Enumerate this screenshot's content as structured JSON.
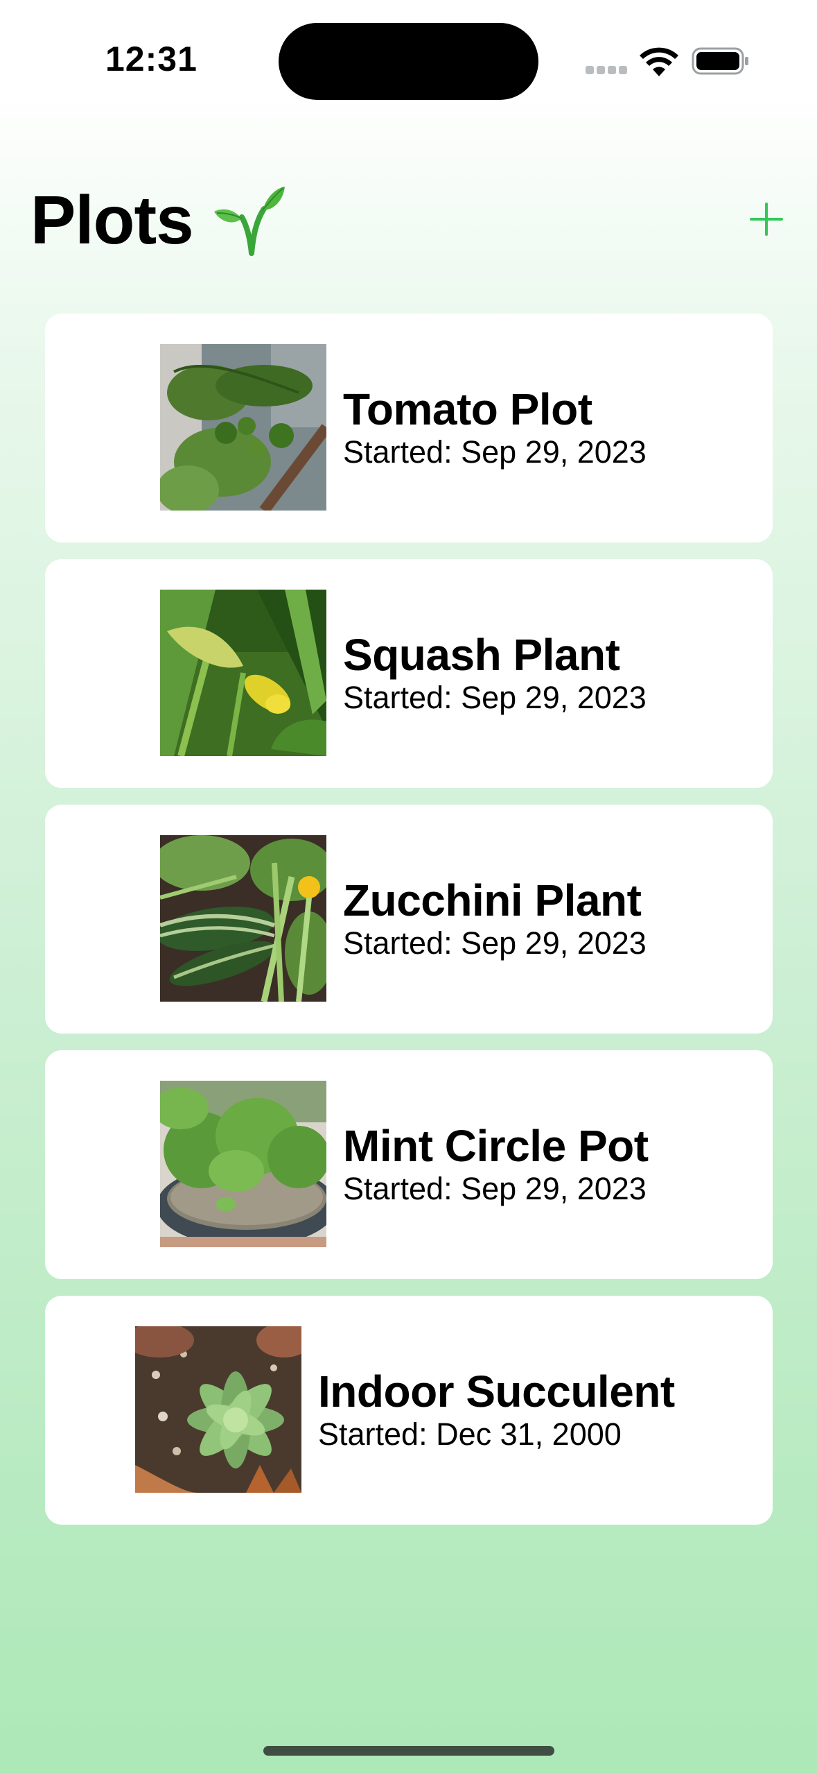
{
  "status_bar": {
    "time": "12:31"
  },
  "header": {
    "title": "Plots",
    "title_icon": "seedling-icon",
    "add_icon": "plus-icon",
    "accent_color": "#34C759"
  },
  "plots": [
    {
      "name": "Tomato Plot",
      "started": "Started: Sep 29, 2023",
      "photo": "tomato-plant-photo"
    },
    {
      "name": "Squash Plant",
      "started": "Started: Sep 29, 2023",
      "photo": "squash-plant-photo"
    },
    {
      "name": "Zucchini Plant",
      "started": "Started: Sep 29, 2023",
      "photo": "zucchini-plant-photo"
    },
    {
      "name": "Mint Circle Pot",
      "started": "Started: Sep 29, 2023",
      "photo": "mint-pot-photo"
    },
    {
      "name": "Indoor Succulent",
      "started": "Started: Dec 31, 2000",
      "photo": "succulent-photo"
    }
  ]
}
